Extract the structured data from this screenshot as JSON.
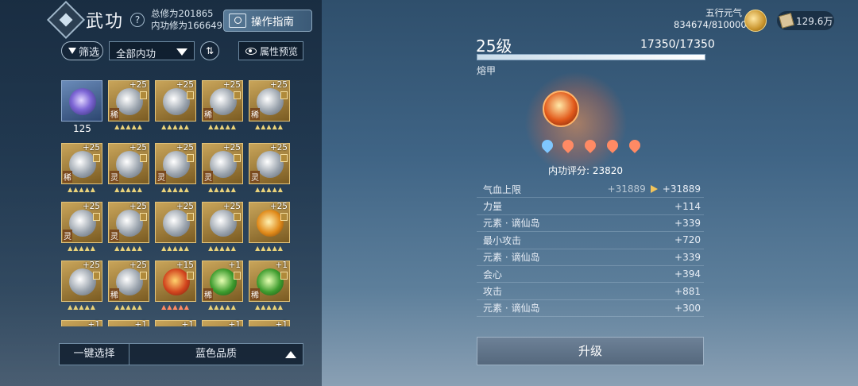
{
  "header": {
    "title": "武功",
    "total_cultivation": "总修为201865",
    "inner_cultivation": "内功修为166649",
    "guide_label": "操作指南"
  },
  "filters": {
    "filter_label": "筛选",
    "select_value": "全部内功",
    "sort_glyph": "⇅",
    "preview_label": "属性预览"
  },
  "grid": {
    "first_count": "125",
    "items": [
      {
        "lvl": "",
        "rare": "",
        "style": "blue"
      },
      {
        "lvl": "+25",
        "rare": "稀",
        "style": ""
      },
      {
        "lvl": "+25",
        "rare": "",
        "style": ""
      },
      {
        "lvl": "+25",
        "rare": "稀",
        "style": ""
      },
      {
        "lvl": "+25",
        "rare": "稀",
        "style": ""
      },
      {
        "lvl": "+25",
        "rare": "稀",
        "style": ""
      },
      {
        "lvl": "+25",
        "rare": "灵",
        "style": ""
      },
      {
        "lvl": "+25",
        "rare": "灵",
        "style": ""
      },
      {
        "lvl": "+25",
        "rare": "灵",
        "style": ""
      },
      {
        "lvl": "+25",
        "rare": "灵",
        "style": ""
      },
      {
        "lvl": "+25",
        "rare": "灵",
        "style": ""
      },
      {
        "lvl": "+25",
        "rare": "灵",
        "style": ""
      },
      {
        "lvl": "+25",
        "rare": "",
        "style": ""
      },
      {
        "lvl": "+25",
        "rare": "",
        "style": ""
      },
      {
        "lvl": "+25",
        "rare": "",
        "style": "star"
      },
      {
        "lvl": "+25",
        "rare": "",
        "style": ""
      },
      {
        "lvl": "+25",
        "rare": "稀",
        "style": ""
      },
      {
        "lvl": "+15",
        "rare": "",
        "style": "red"
      },
      {
        "lvl": "+1",
        "rare": "稀",
        "style": "green"
      },
      {
        "lvl": "+1",
        "rare": "稀",
        "style": "green"
      },
      {
        "lvl": "+1",
        "rare": "",
        "style": ""
      },
      {
        "lvl": "+1",
        "rare": "",
        "style": ""
      },
      {
        "lvl": "+1",
        "rare": "",
        "style": ""
      },
      {
        "lvl": "+1",
        "rare": "",
        "style": ""
      },
      {
        "lvl": "+1",
        "rare": "",
        "style": ""
      }
    ]
  },
  "bottom": {
    "one_key": "一键选择",
    "quality": "蓝色品质"
  },
  "resources": {
    "wuxing_label": "五行元气",
    "wuxing_value": "834674/810000",
    "currency": "129.6万"
  },
  "detail": {
    "level": "25级",
    "exp": "17350/17350",
    "exp_fraction": 1.0,
    "name": "熔甲",
    "score": "内功评分: 23820",
    "elements": [
      "water",
      "fire",
      "fire",
      "fire",
      "fire"
    ],
    "stats": [
      {
        "label": "气血上限",
        "old": "+31889",
        "value": "+31889"
      },
      {
        "label": "力量",
        "old": "",
        "value": "+114"
      },
      {
        "label": "元素 · 谪仙岛",
        "old": "",
        "value": "+339"
      },
      {
        "label": "最小攻击",
        "old": "",
        "value": "+720"
      },
      {
        "label": "元素 · 谪仙岛",
        "old": "",
        "value": "+339"
      },
      {
        "label": "会心",
        "old": "",
        "value": "+394"
      },
      {
        "label": "攻击",
        "old": "",
        "value": "+881"
      },
      {
        "label": "元素 · 谪仙岛",
        "old": "",
        "value": "+300"
      }
    ],
    "upgrade_label": "升级"
  }
}
